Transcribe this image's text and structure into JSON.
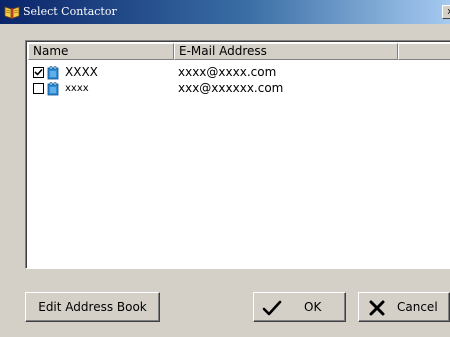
{
  "window": {
    "title": "Select Contactor",
    "close_symbol": "x"
  },
  "list": {
    "columns": [
      "Name",
      "E-Mail Address",
      ""
    ],
    "rows": [
      {
        "checked": true,
        "icon": "contact-card-icon",
        "name": "XXXX",
        "email": "xxxx@xxxx.com"
      },
      {
        "checked": false,
        "icon": "contact-card-icon",
        "name": "xxxx",
        "email": "xxx@xxxxxx.com"
      }
    ]
  },
  "buttons": {
    "edit_label": "Edit Address Book",
    "ok_label": "OK",
    "cancel_label": "Cancel"
  },
  "icons": {
    "title": "address-book-icon",
    "ok": "checkmark-icon",
    "cancel": "x-icon"
  },
  "colors": {
    "titlebar_start": "#0a246a",
    "titlebar_end": "#a6caf0",
    "face": "#d4d0c8",
    "contact_icon": "#2a8fd8"
  }
}
